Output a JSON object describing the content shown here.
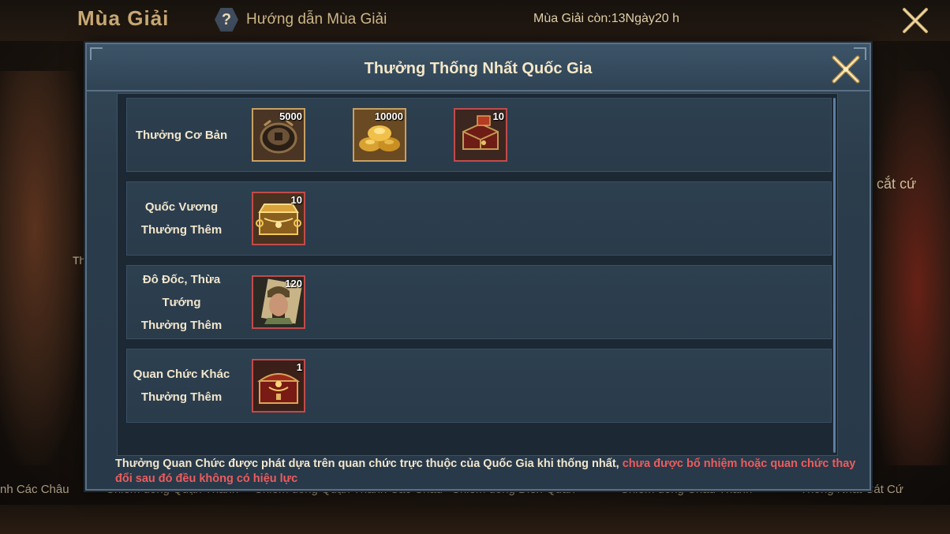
{
  "background": {
    "season_title": "Mùa Giải",
    "help_label": "Hướng dẫn Mùa Giải",
    "help_icon_glyph": "?",
    "season_remaining": "Mùa Giải còn:13Ngày20 h",
    "right_side_text": "ư cắt cứ",
    "left_side_text": "Th",
    "tabs": [
      "nh Các Châu",
      "Chiếm đóng Quận Thành",
      "Chiếm đóng Quận Thành Các Châu",
      "Chiếm đóng Điền Quan",
      "Chiếm đóng Châu Thành",
      "Thống Nhất Cát Cứ"
    ]
  },
  "modal": {
    "title": "Thưởng Thống Nhất Quốc Gia",
    "rows": [
      {
        "label_lines": [
          "Thưởng Cơ Bản"
        ],
        "items": [
          {
            "icon": "coin-icon",
            "qty": "5000",
            "frame": "gold"
          },
          {
            "icon": "gold-ingot-icon",
            "qty": "10000",
            "frame": "gold"
          },
          {
            "icon": "red-chest-icon",
            "qty": "10",
            "frame": "red"
          }
        ]
      },
      {
        "label_lines": [
          "Quốc Vương",
          "Thưởng Thêm"
        ],
        "items": [
          {
            "icon": "gold-chest-icon",
            "qty": "10",
            "frame": "red"
          }
        ]
      },
      {
        "label_lines": [
          "Đô Đốc, Thừa Tướng",
          "Thưởng Thêm"
        ],
        "items": [
          {
            "icon": "general-portrait-icon",
            "qty": "120",
            "frame": "red"
          }
        ]
      },
      {
        "label_lines": [
          "Quan Chức Khác",
          "Thưởng Thêm"
        ],
        "items": [
          {
            "icon": "ornate-chest-icon",
            "qty": "1",
            "frame": "red"
          }
        ]
      }
    ],
    "footer_note": "Thưởng Quan Chức được phát dựa trên quan chức trực thuộc của Quốc Gia khi thống nhất,",
    "footer_warning": " chưa được bổ nhiệm hoặc quan chức thay đổi sau đó đều không có hiệu lực"
  },
  "colors": {
    "modal_bg": "#2b3c4b",
    "gold_frame": "#c8a064",
    "red_frame": "#c14b4b",
    "warning_text": "#ec5c5c",
    "title_text": "#f4e7c8"
  }
}
